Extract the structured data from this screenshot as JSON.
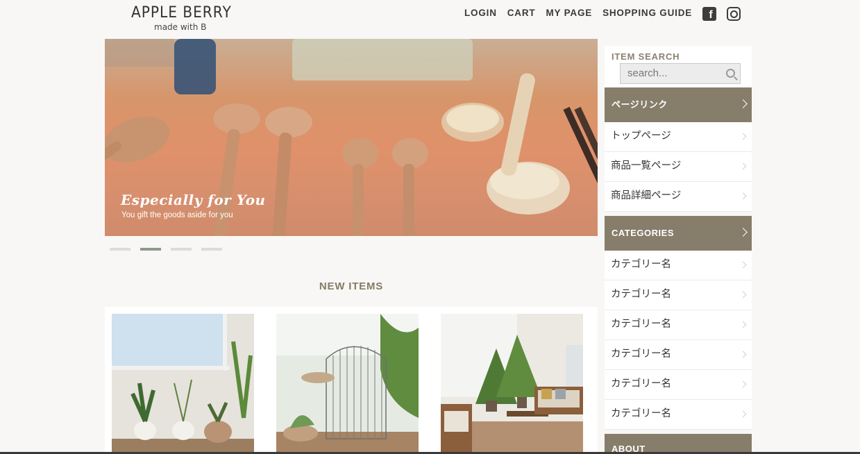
{
  "header": {
    "logo_title": "APPLE BERRY",
    "logo_sub": "made with B",
    "nav": [
      "LOGIN",
      "CART",
      "MY PAGE",
      "SHOPPING GUIDE"
    ],
    "social_icons": [
      "facebook-icon",
      "instagram-icon"
    ]
  },
  "hero": {
    "title": "Especially for You",
    "subtitle": "You gift the goods aside for you",
    "slides": 4,
    "active_slide": 2
  },
  "new_items": {
    "title": "NEW ITEMS"
  },
  "sidebar": {
    "search_label": "ITEM SEARCH",
    "search_placeholder": "search...",
    "page_links_title": "ページリンク",
    "page_links": [
      "トップページ",
      "商品一覧ページ",
      "商品詳細ページ"
    ],
    "categories_title": "CATEGORIES",
    "categories": [
      "カテゴリー名",
      "カテゴリー名",
      "カテゴリー名",
      "カテゴリー名",
      "カテゴリー名",
      "カテゴリー名"
    ],
    "about_title": "ABOUT"
  },
  "colors": {
    "accent": "#867d6a",
    "active_dot": "#8a9a8d",
    "background": "#f8f7f5"
  }
}
